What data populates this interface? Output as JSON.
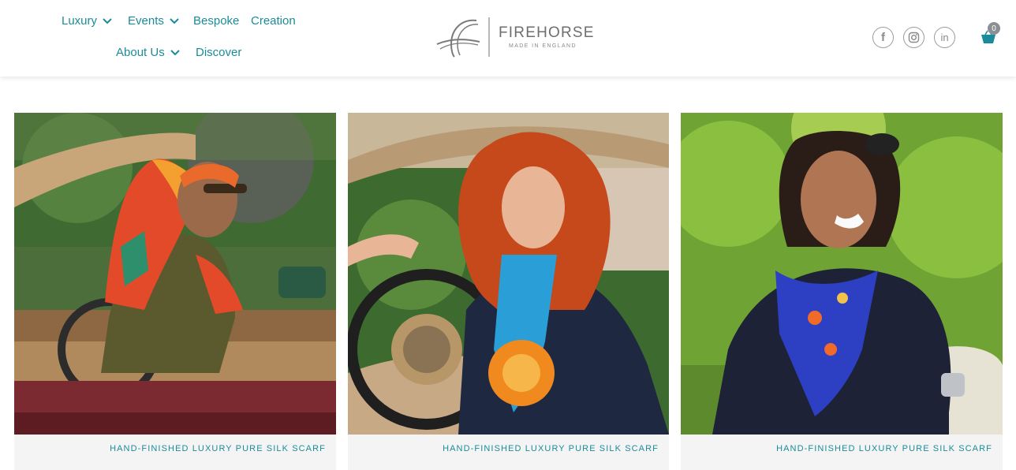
{
  "nav": {
    "items": [
      {
        "label": "Luxury",
        "has_dropdown": true
      },
      {
        "label": "Events",
        "has_dropdown": true
      },
      {
        "label": "Bespoke",
        "has_dropdown": false
      },
      {
        "label": "Creation",
        "has_dropdown": false
      },
      {
        "label": "About Us",
        "has_dropdown": true
      },
      {
        "label": "Discover",
        "has_dropdown": false
      }
    ]
  },
  "logo": {
    "name": "FIREHORSE",
    "tagline": "MADE IN ENGLAND"
  },
  "social": [
    {
      "icon": "facebook-icon",
      "glyph": "f"
    },
    {
      "icon": "instagram-icon",
      "glyph": ""
    },
    {
      "icon": "linkedin-icon",
      "glyph": "in"
    }
  ],
  "cart": {
    "icon": "basket-icon",
    "count": "0"
  },
  "products": [
    {
      "label": "HAND-FINISHED LUXURY PURE SILK SCARF",
      "image": "woman-in-convertible-orange-silk-headscarf"
    },
    {
      "label": "HAND-FINISHED LUXURY PURE SILK SCARF",
      "image": "red-haired-woman-at-steering-wheel-blue-orange-scarf"
    },
    {
      "label": "HAND-FINISHED LUXURY PURE SILK SCARF",
      "image": "smiling-woman-navy-top-blue-floral-neckscarf"
    }
  ],
  "colors": {
    "accent": "#1a8c99",
    "logo_grey": "#6e6e6e"
  }
}
